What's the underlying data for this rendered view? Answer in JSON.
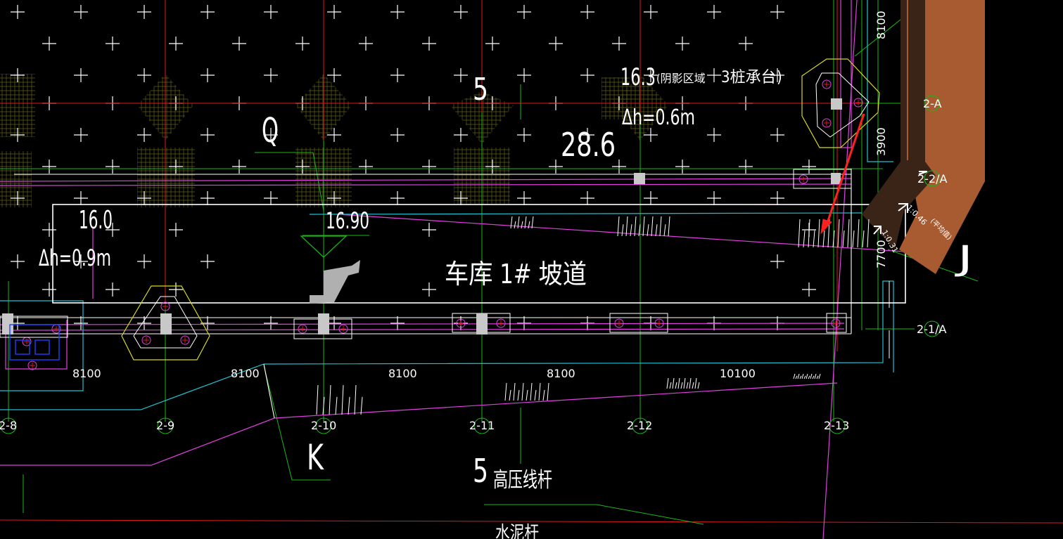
{
  "colors": {
    "background": "#000000",
    "grid_red": "#e01818",
    "grid_green": "#18b818",
    "magenta": "#e040e0",
    "cyan": "#20c0d0",
    "yellow": "#d8d820",
    "white": "#ffffff",
    "slope_brown": "#a85a30",
    "slope_dark": "#3a2418",
    "arrow_red": "#ff2020"
  },
  "axis_labels": {
    "a_2_8": "2-8",
    "a_2_9": "2-9",
    "a_2_10": "2-10",
    "a_2_11": "2-11",
    "a_2_12": "2-12",
    "a_2_13": "2-13",
    "a_2_A": "2-A",
    "a_2_2A": "2-2/A",
    "a_2_1A": "2-1/A"
  },
  "dimensions": {
    "d1": "8100",
    "d2": "8100",
    "d3": "8100",
    "d4": "8100",
    "d5": "10100",
    "v_top": "8100",
    "v_mid": "3900",
    "v_bot": "7700"
  },
  "annotations": {
    "shadow_prefix": "16.3",
    "shadow_label": "(阴影区域",
    "pile_cap": "3桩承台",
    "paren_close": ")",
    "dh_top": "Δh=0.6m",
    "elev_28": "28.6",
    "letter_q": "Q",
    "num_5_top": "5",
    "elev_16_0": "16.0",
    "dh_left": "Δh=0.9m",
    "elev_16_90": "16.90",
    "garage_ramp": "车库 1# 坡道",
    "letter_k": "K",
    "num_5_bottom": "5",
    "hv_pole": "高压线杆",
    "cement_pole": "水泥杆",
    "letter_j": "J",
    "slope_1": "1:0.46",
    "slope_2": "1:0.31",
    "slope_note": "(平均值)"
  }
}
